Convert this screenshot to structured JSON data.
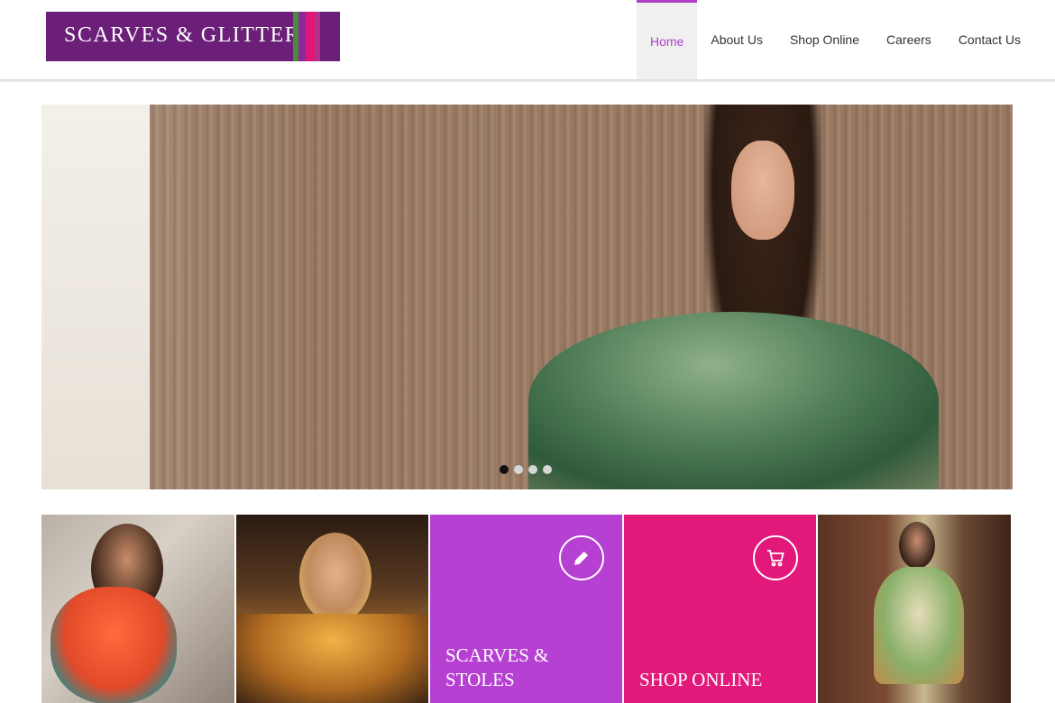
{
  "site": {
    "logo_text": "SCARVES & GLITTERS",
    "brand_color": "#6b1f78",
    "logo_stripes": [
      "#4a8a3c",
      "#8a2a9a",
      "#e0157a",
      "#b0308a"
    ]
  },
  "nav": {
    "items": [
      {
        "label": "Home",
        "active": true
      },
      {
        "label": "About Us",
        "active": false
      },
      {
        "label": "Shop Online",
        "active": false
      },
      {
        "label": "Careers",
        "active": false
      },
      {
        "label": "Contact Us",
        "active": false
      }
    ],
    "active_color": "#b040c8"
  },
  "hero": {
    "slide_count": 4,
    "current_slide": 1
  },
  "tiles": {
    "scarves": {
      "label_line1": "SCARVES &",
      "label_line2": "STOLES",
      "icon": "pencil-icon",
      "color": "#b640d2"
    },
    "shop": {
      "label": "SHOP ONLINE",
      "icon": "cart-icon",
      "color": "#e2197b"
    }
  }
}
